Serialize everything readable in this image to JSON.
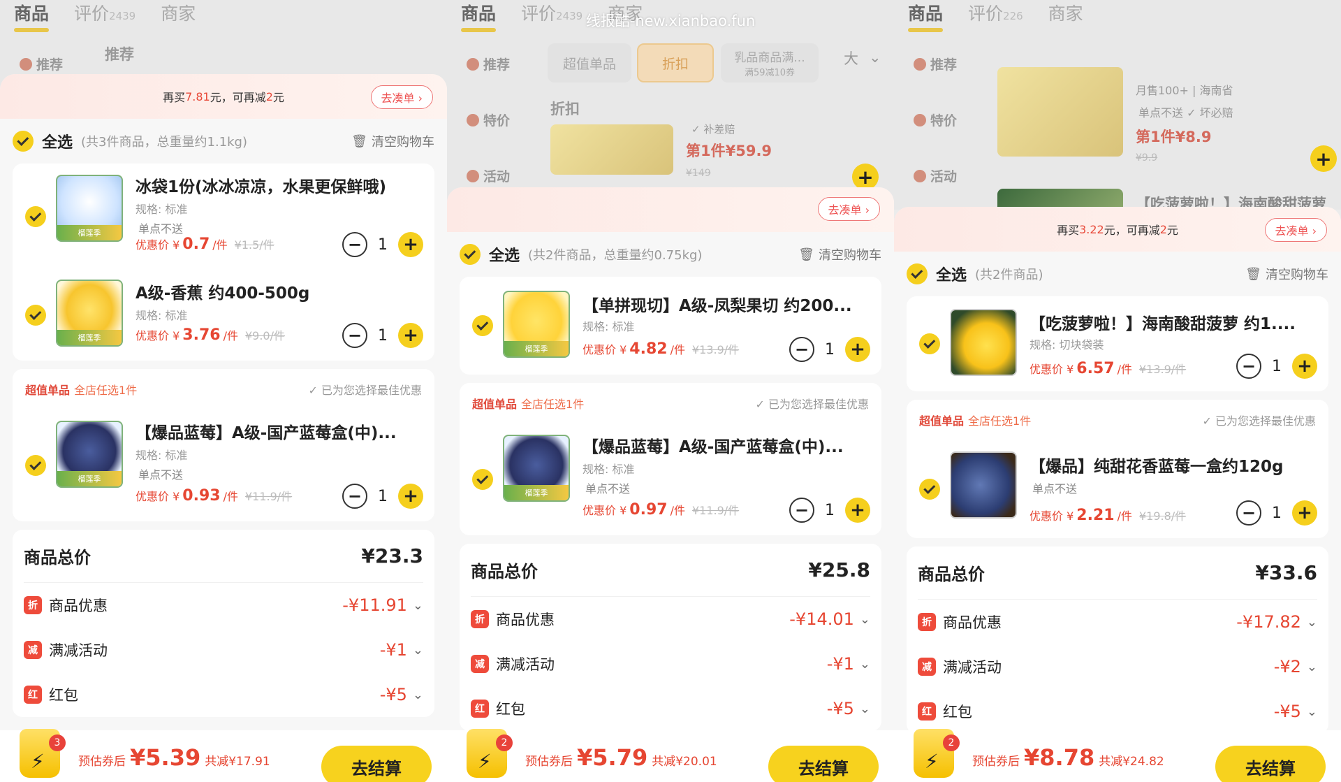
{
  "watermark": "线报酷-new.xianbao.fun",
  "tabs": {
    "goods": "商品",
    "review": "评价",
    "merchant": "商家"
  },
  "side": {
    "recommend": "推荐",
    "special": "特价",
    "activity": "活动"
  },
  "actions": {
    "clear": "清空购物车",
    "best": "已为您选择最佳优惠",
    "checkout": "去结算",
    "gather": "去凑单 ›",
    "unit": "/件",
    "price_prefix": "优惠价 ¥",
    "plus": "+",
    "minus": "−"
  },
  "labels": {
    "total": "商品总价",
    "discount": "商品优惠",
    "full_reduction": "满减活动",
    "red_packet": "红包",
    "estimate": "预估券后",
    "ic_discount": "折",
    "ic_full": "减",
    "ic_red": "红"
  },
  "panels": [
    {
      "review_count": "2439",
      "bg": {
        "recommend_title": "推荐"
      },
      "promo": {
        "pre": "再买",
        "amt": "7.81",
        "mid": "元，可再减",
        "red": "2",
        "post": "元"
      },
      "select_all": {
        "label": "全选",
        "hint": "(共3件商品，总重量约1.1kg)"
      },
      "items": [
        {
          "name": "冰袋1份(冰冰凉凉，水果更保鲜哦)",
          "spec": "规格: 标准",
          "note": "单点不送",
          "price": "0.7",
          "orig": "¥1.5/件",
          "qty": "1",
          "badge": "榴莲季"
        },
        {
          "name": "A级-香蕉 约400-500g",
          "spec": "规格: 标准",
          "note": "",
          "price": "3.76",
          "orig": "¥9.0/件",
          "qty": "1",
          "badge": "榴莲季"
        }
      ],
      "group": {
        "t1": "超值单品",
        "t2": "全店任选1件",
        "item": {
          "name": "【爆品蓝莓】A级-国产蓝莓盒(中)...",
          "spec": "规格: 标准",
          "note": "单点不送",
          "price": "0.93",
          "orig": "¥11.9/件",
          "qty": "1",
          "badge": "榴莲季"
        }
      },
      "summary": {
        "total": "¥23.3",
        "discount": "-¥11.91",
        "full": "-¥1",
        "red": "-¥5"
      },
      "footer": {
        "badge": "3",
        "est": "¥5.39",
        "saved": "共减¥17.91"
      }
    },
    {
      "review_count": "2439",
      "bg": {
        "chip1": "超值单品",
        "chip2": "折扣",
        "chip3": "乳品商品满...",
        "chip3_sub": "满59减10券",
        "chip4": "大",
        "section": "折扣",
        "tag": "补差赔",
        "price": "第1件¥59.9",
        "orig": "¥149"
      },
      "promo": {
        "pre": "",
        "amt": "",
        "mid": "",
        "red": "",
        "post": ""
      },
      "select_all": {
        "label": "全选",
        "hint": "(共2件商品，总重量约0.75kg)"
      },
      "items": [
        {
          "name": "【单拼现切】A级-凤梨果切 约200...",
          "spec": "规格: 标准",
          "note": "",
          "price": "4.82",
          "orig": "¥13.9/件",
          "qty": "1",
          "badge": "榴莲季"
        }
      ],
      "group": {
        "t1": "超值单品",
        "t2": "全店任选1件",
        "item": {
          "name": "【爆品蓝莓】A级-国产蓝莓盒(中)...",
          "spec": "规格: 标准",
          "note": "单点不送",
          "price": "0.97",
          "orig": "¥11.9/件",
          "qty": "1",
          "badge": "榴莲季"
        }
      },
      "summary": {
        "total": "¥25.8",
        "discount": "-¥14.01",
        "full": "-¥1",
        "red": "-¥5"
      },
      "footer": {
        "badge": "2",
        "est": "¥5.79",
        "saved": "共减¥20.01"
      }
    },
    {
      "review_count": "226",
      "bg": {
        "sales": "月售100+",
        "origin": "海南省",
        "note": "单点不送",
        "tag": "坏必赔",
        "price": "第1件¥8.9",
        "orig": "¥9.9",
        "next": "【吃菠萝啦！】海南酸甜菠萝"
      },
      "promo": {
        "pre": "再买",
        "amt": "3.22",
        "mid": "元，可再减",
        "red": "2",
        "post": "元"
      },
      "select_all": {
        "label": "全选",
        "hint": "(共2件商品)"
      },
      "items": [
        {
          "name": "【吃菠萝啦！】海南酸甜菠萝 约1....",
          "spec": "规格: 切块袋装",
          "note": "",
          "price": "6.57",
          "orig": "¥13.9/件",
          "qty": "1",
          "badge": ""
        }
      ],
      "group": {
        "t1": "超值单品",
        "t2": "全店任选1件",
        "item": {
          "name": "【爆品】纯甜花香蓝莓一盒约120g",
          "spec": "",
          "note": "单点不送",
          "price": "2.21",
          "orig": "¥19.8/件",
          "qty": "1",
          "badge": ""
        }
      },
      "summary": {
        "total": "¥33.6",
        "discount": "-¥17.82",
        "full": "-¥2",
        "red": "-¥5"
      },
      "footer": {
        "badge": "2",
        "est": "¥8.78",
        "saved": "共减¥24.82"
      }
    }
  ],
  "colors": {
    "accent": "#f5cf1d",
    "price": "#e64632"
  }
}
